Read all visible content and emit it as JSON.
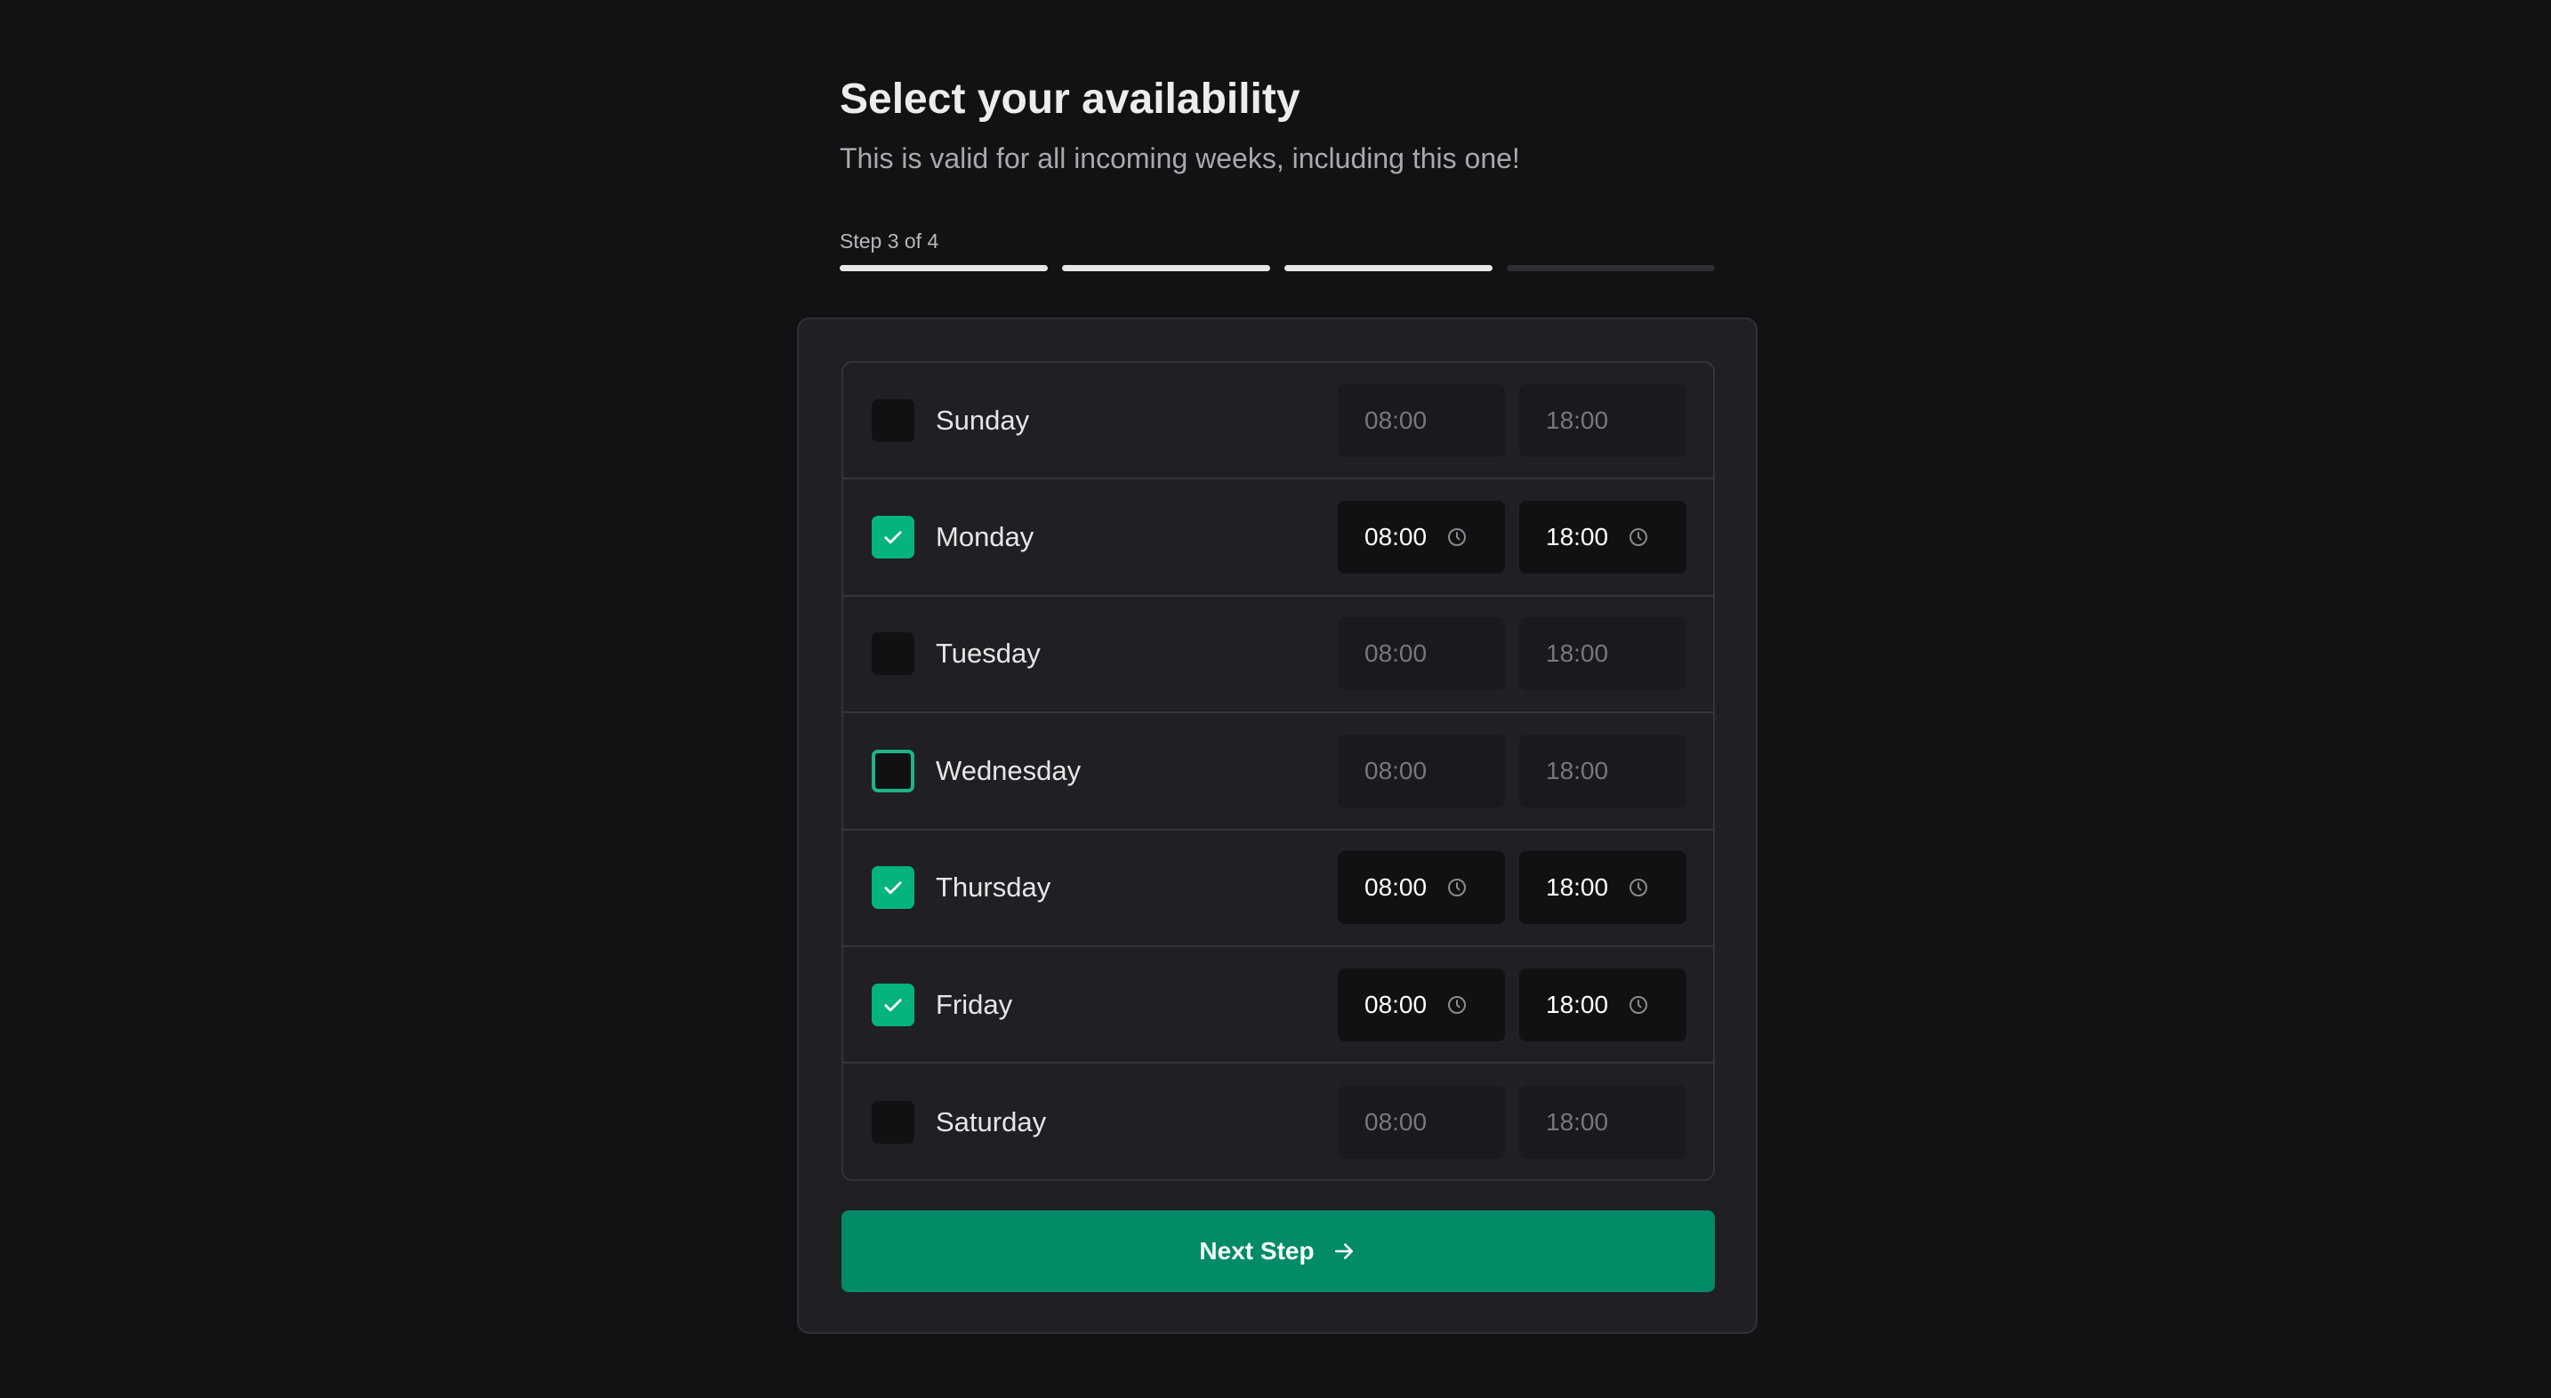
{
  "header": {
    "title": "Select your availability",
    "subtitle": "This is valid for all incoming weeks, including this one!"
  },
  "progress": {
    "label": "Step 3 of 4",
    "current": 3,
    "total": 4
  },
  "colors": {
    "accent": "#05b37f",
    "button": "#038a67",
    "background": "#121215"
  },
  "days": [
    {
      "name": "Sunday",
      "checked": false,
      "start": "08:00",
      "end": "18:00"
    },
    {
      "name": "Monday",
      "checked": true,
      "start": "08:00",
      "end": "18:00"
    },
    {
      "name": "Tuesday",
      "checked": false,
      "start": "08:00",
      "end": "18:00"
    },
    {
      "name": "Wednesday",
      "checked": false,
      "focused": true,
      "start": "08:00",
      "end": "18:00"
    },
    {
      "name": "Thursday",
      "checked": true,
      "start": "08:00",
      "end": "18:00"
    },
    {
      "name": "Friday",
      "checked": true,
      "start": "08:00",
      "end": "18:00"
    },
    {
      "name": "Saturday",
      "checked": false,
      "start": "08:00",
      "end": "18:00"
    }
  ],
  "button": {
    "label": "Next Step",
    "icon": "arrow-right-icon"
  }
}
